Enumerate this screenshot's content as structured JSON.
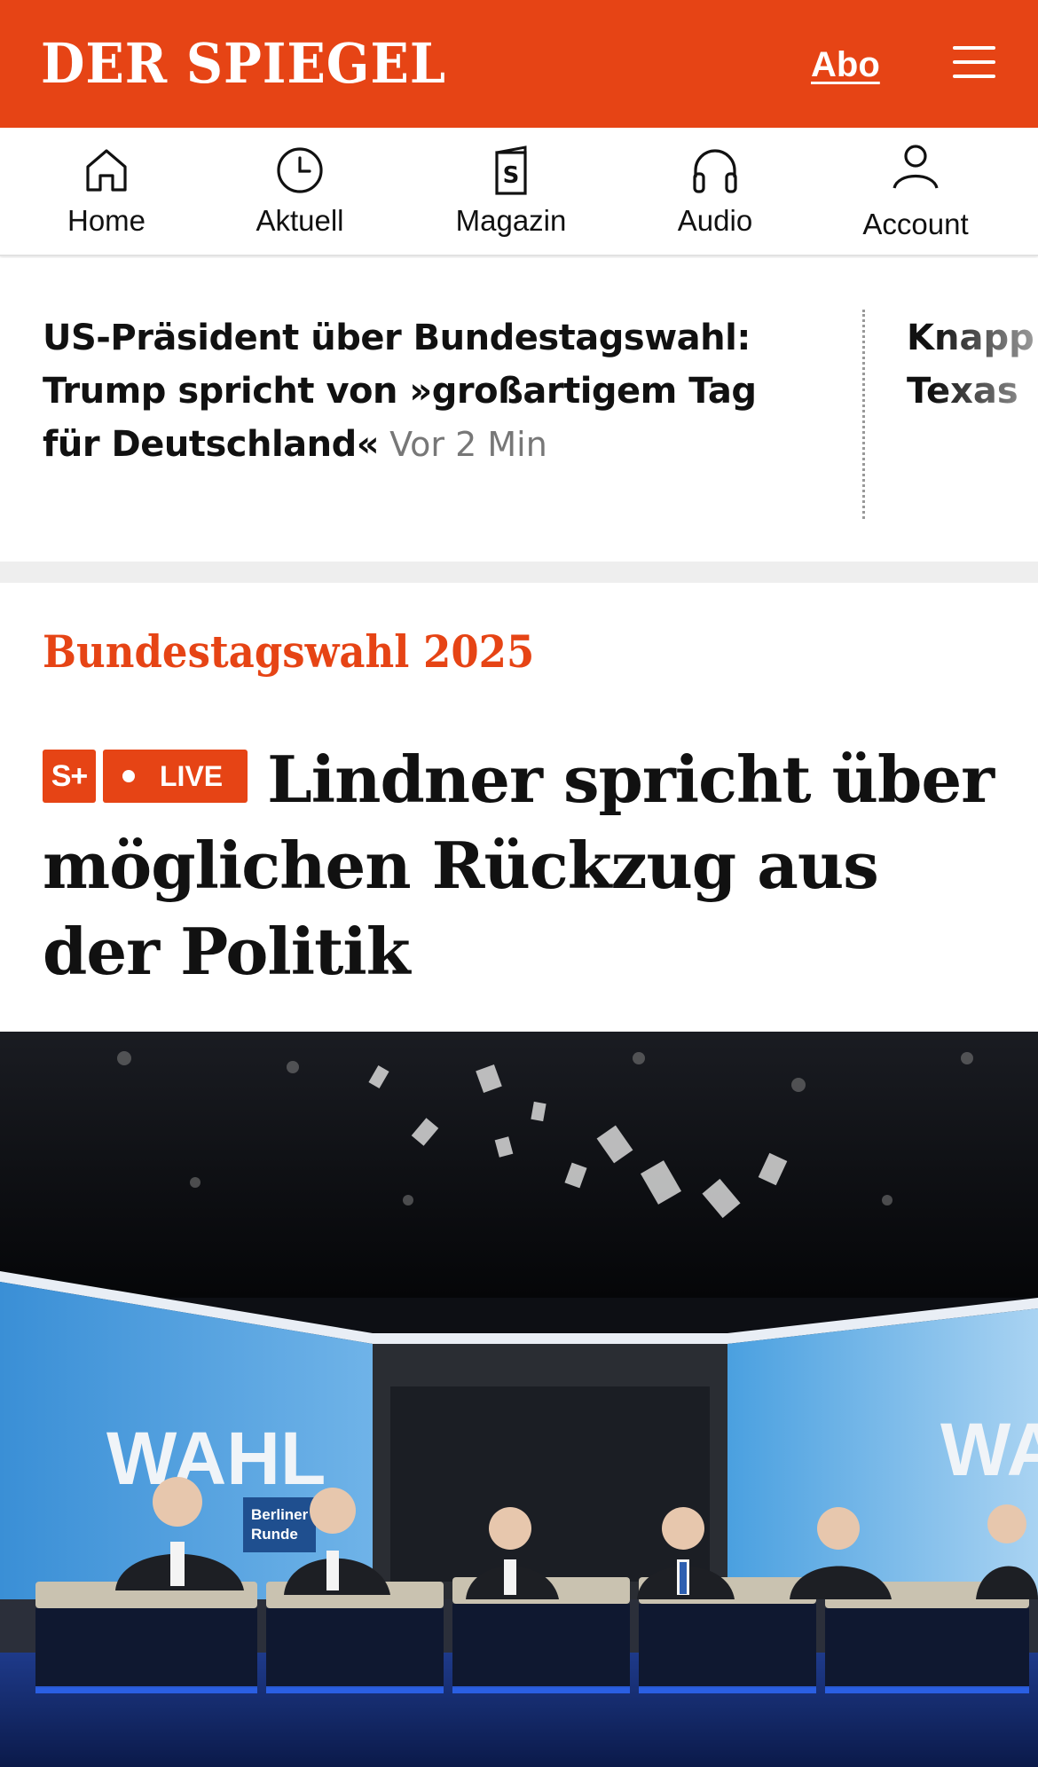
{
  "header": {
    "logo": "DER SPIEGEL",
    "abo_label": "Abo",
    "menu_icon": "hamburger-menu-icon",
    "brand_color": "#e64415"
  },
  "nav": {
    "items": [
      {
        "label": "Home",
        "icon": "home-icon"
      },
      {
        "label": "Aktuell",
        "icon": "clock-icon"
      },
      {
        "label": "Magazin",
        "icon": "magazine-icon"
      },
      {
        "label": "Audio",
        "icon": "headphones-icon"
      },
      {
        "label": "Account",
        "icon": "user-icon"
      }
    ]
  },
  "ticker": {
    "items": [
      {
        "title": "US-Präsident über Bundestagswahl: Trump spricht von »großartigem Tag für Deutschland«",
        "time": "Vor 2 Min"
      },
      {
        "title_line1": "Knapp",
        "title_line2": "Texas"
      }
    ]
  },
  "article": {
    "kicker": "Bundestagswahl 2025",
    "splus_badge": "S+",
    "live_badge": "LIVE",
    "headline": "Lindner spricht über möglichen Rückzug aus der Politik",
    "image": {
      "sign_left": "WAHL",
      "sign_small_line1": "Berliner",
      "sign_small_line2": "Runde",
      "sign_right": "WA"
    }
  }
}
